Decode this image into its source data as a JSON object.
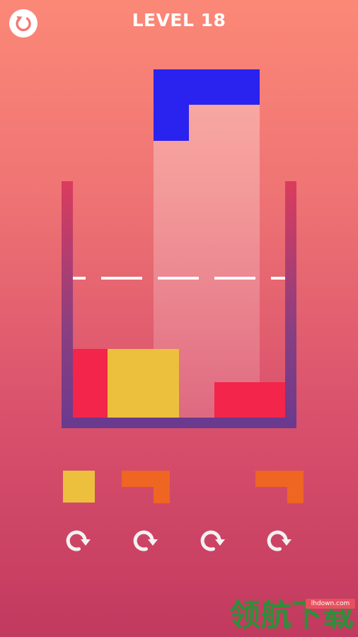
{
  "hud": {
    "level_label": "LEVEL 18",
    "restart_icon": "restart-icon"
  },
  "falling_piece": {
    "shape": "L",
    "color": "#2a22ee"
  },
  "cup": {
    "wall_color": "#db3c5e",
    "floor_color": "#6a3a8f",
    "target_line_color": "#ffffff"
  },
  "placed_blocks": [
    {
      "color": "#f3254a"
    },
    {
      "color": "#ecc03c"
    },
    {
      "color": "#f3254a"
    }
  ],
  "tray": {
    "pieces": [
      {
        "shape": "square",
        "color": "#ecc03c"
      },
      {
        "shape": "L",
        "color": "#ee6622"
      },
      {
        "shape": "empty",
        "color": ""
      },
      {
        "shape": "L",
        "color": "#ee6622"
      }
    ],
    "rotate_icon": "rotate-clockwise-icon"
  },
  "watermark": {
    "url": "lhdown.com",
    "text": "领航下载"
  }
}
